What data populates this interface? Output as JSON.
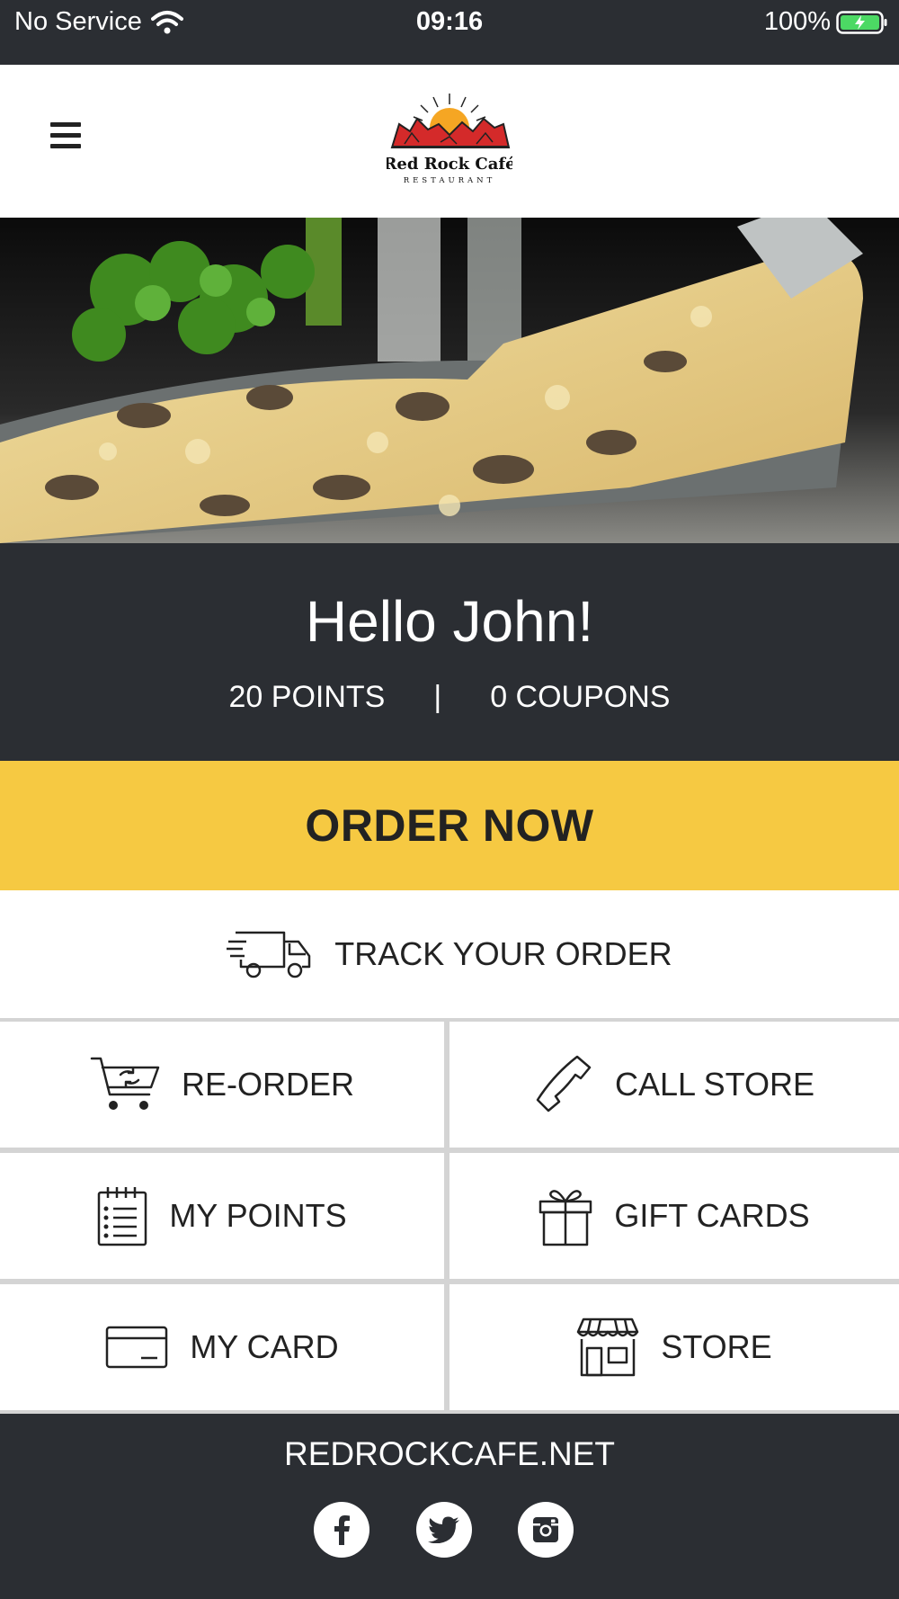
{
  "status_bar": {
    "carrier": "No Service",
    "time": "09:16",
    "battery": "100%"
  },
  "header": {
    "logo_name": "Red Rock Café",
    "logo_sub": "RESTAURANT"
  },
  "greeting": {
    "hello": "Hello John!",
    "points": "20 POINTS",
    "separator": "|",
    "coupons": "0 COUPONS"
  },
  "actions": {
    "order_now": "ORDER NOW",
    "track_order": "TRACK YOUR ORDER",
    "reorder": "RE-ORDER",
    "call_store": "CALL STORE",
    "my_points": "MY POINTS",
    "gift_cards": "GIFT CARDS",
    "my_card": "MY CARD",
    "store": "STORE"
  },
  "footer": {
    "website": "REDROCKCAFE.NET"
  },
  "colors": {
    "dark": "#2b2e33",
    "accent": "#f6c942",
    "battery_green": "#4cd964"
  }
}
